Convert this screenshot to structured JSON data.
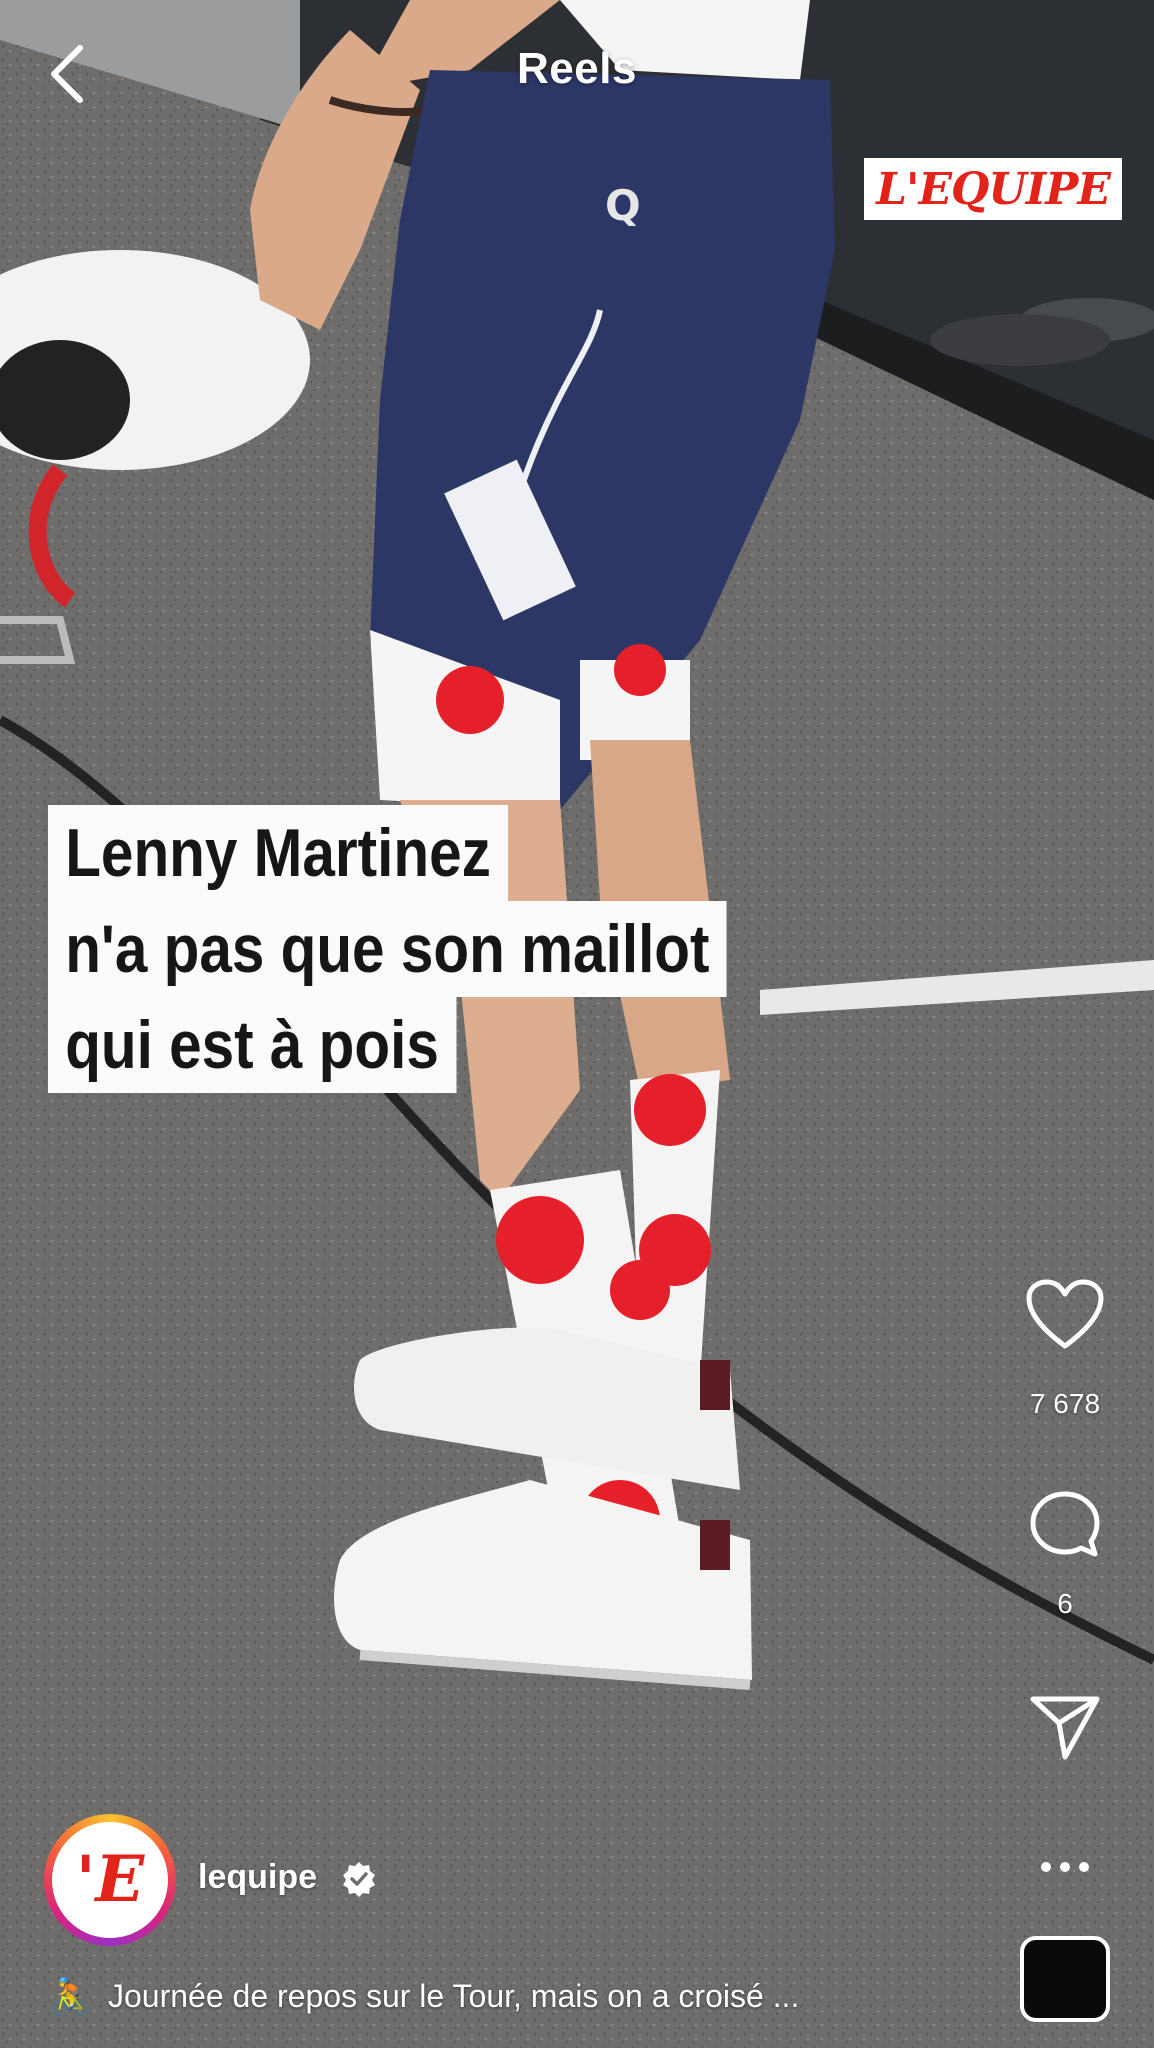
{
  "header": {
    "title": "Reels",
    "back_icon": "chevron-left-icon"
  },
  "watermark": {
    "text": "L'EQUIPE",
    "color": "#e2231a"
  },
  "caption": {
    "lines": [
      "Lenny Martinez",
      "n'a pas que son maillot",
      "qui est à pois"
    ]
  },
  "actions": {
    "like": {
      "icon": "heart-icon",
      "count": "7 678"
    },
    "comment": {
      "icon": "comment-icon",
      "count": "6"
    },
    "share": {
      "icon": "send-icon"
    },
    "more": {
      "icon": "more-icon"
    }
  },
  "account": {
    "avatar_text": "'E",
    "username": "lequipe",
    "verified_icon": "verified-badge-icon"
  },
  "post": {
    "emoji": "🚴",
    "description": "Journée de repos sur le Tour, mais on a croisé ..."
  },
  "audio": {
    "icon": "audio-thumbnail"
  }
}
